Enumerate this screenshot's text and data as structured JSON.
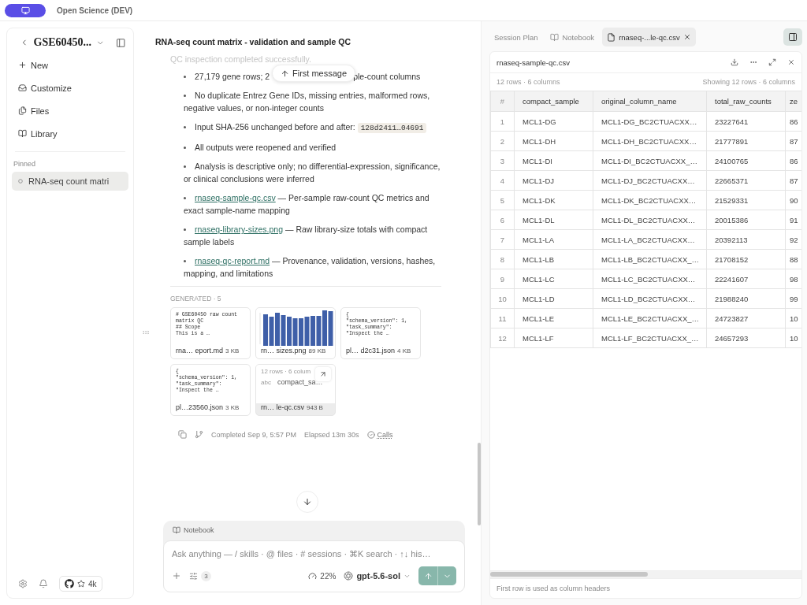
{
  "app": {
    "title": "Open Science (DEV)"
  },
  "sidebar": {
    "project": "GSE60450...",
    "nav": [
      {
        "label": "New"
      },
      {
        "label": "Customize"
      },
      {
        "label": "Files"
      },
      {
        "label": "Library"
      }
    ],
    "pinned_label": "Pinned",
    "pinned": [
      {
        "label": "RNA-seq count matri",
        "selected": true
      }
    ],
    "github_stars": "4k"
  },
  "chat": {
    "title": "RNA-seq count matrix - validation and sample QC",
    "faded_line": "QC inspection completed successfully.",
    "jump_button": "First message",
    "bullets": [
      {
        "kind": "split",
        "before": "27,179 gene rows; 2",
        "after": "ple-count columns"
      },
      {
        "kind": "text",
        "text": "No duplicate Entrez Gene IDs, missing entries, malformed rows, negative values, or non-integer counts"
      },
      {
        "kind": "code",
        "text": "Input SHA-256 unchanged before and after:",
        "code": "128d2411…04691"
      },
      {
        "kind": "text",
        "text": "All outputs were reopened and verified"
      },
      {
        "kind": "text",
        "text": "Analysis is descriptive only; no differential-expression, significance, or clinical conclusions were inferred"
      },
      {
        "kind": "link",
        "link": "rnaseq-sample-qc.csv",
        "text": " — Per-sample raw-count QC metrics and exact sample-name mapping"
      },
      {
        "kind": "link",
        "link": "rnaseq-library-sizes.png",
        "text": " — Raw library-size totals with compact sample labels"
      },
      {
        "kind": "link",
        "link": "rnaseq-qc-report.md",
        "text": " — Provenance, validation, versions, hashes, mapping, and limitations"
      }
    ],
    "generated_label": "GENERATED · 5",
    "files": [
      {
        "kind": "text",
        "preview": "# GSE60450 raw count\nmatrix QC\n## Scope\nThis is a …",
        "name": "rna… eport.md",
        "size": "3 KB",
        "selected": false
      },
      {
        "name": "rn… sizes.png",
        "size": "89 KB",
        "selected": false
      },
      {
        "kind": "text",
        "preview": "{\n\"schema_version\": 1,\n\"task_summary\":\n\"Inspect the …",
        "name": "pl… d2c31.json",
        "size": "4 KB",
        "selected": false
      },
      {
        "kind": "text",
        "preview": "{\n\"schema_version\": 1,\n\"task_summary\":\n\"Inspect the …",
        "name": "pl…23560.json",
        "size": "3 KB",
        "selected": false
      },
      {
        "kind": "table",
        "meta": "12 rows · 6 colum",
        "col_type": "abc",
        "col_name": "compact_sa…",
        "name": "rn… le-qc.csv",
        "size": "943 B",
        "selected": true
      }
    ],
    "completed": "Completed Sep 9, 5:57 PM",
    "elapsed": "Elapsed 13m 30s",
    "calls": "Calls"
  },
  "composer": {
    "mode": "Notebook",
    "placeholder": "Ask anything — / skills · @ files · # sessions · ⌘K search · ↑↓ his…",
    "tools_count": "3",
    "context": "22%",
    "model": "gpt-5.6-sol"
  },
  "panel": {
    "tabs": [
      {
        "label": "Session Plan",
        "selected": false,
        "closable": false
      },
      {
        "label": "Notebook",
        "selected": false,
        "closable": false
      },
      {
        "label": "rnaseq-...le-qc.csv",
        "selected": true,
        "closable": true
      }
    ],
    "file_title": "rnaseq-sample-qc.csv",
    "summary": "12 rows · 6 columns",
    "showing": "Showing 12 rows · 6 columns",
    "columns": [
      "#",
      "compact_sample",
      "original_column_name",
      "total_raw_counts",
      "ze"
    ],
    "rows": [
      [
        "1",
        "MCL1-DG",
        "MCL1-DG_BC2CTUACXX…",
        "23227641",
        "86"
      ],
      [
        "2",
        "MCL1-DH",
        "MCL1-DH_BC2CTUACXX…",
        "21777891",
        "87"
      ],
      [
        "3",
        "MCL1-DI",
        "MCL1-DI_BC2CTUACXX_…",
        "24100765",
        "86"
      ],
      [
        "4",
        "MCL1-DJ",
        "MCL1-DJ_BC2CTUACXX…",
        "22665371",
        "87"
      ],
      [
        "5",
        "MCL1-DK",
        "MCL1-DK_BC2CTUACXX…",
        "21529331",
        "90"
      ],
      [
        "6",
        "MCL1-DL",
        "MCL1-DL_BC2CTUACXX…",
        "20015386",
        "91"
      ],
      [
        "7",
        "MCL1-LA",
        "MCL1-LA_BC2CTUACXX…",
        "20392113",
        "92"
      ],
      [
        "8",
        "MCL1-LB",
        "MCL1-LB_BC2CTUACXX_…",
        "21708152",
        "88"
      ],
      [
        "9",
        "MCL1-LC",
        "MCL1-LC_BC2CTUACXX…",
        "22241607",
        "98"
      ],
      [
        "10",
        "MCL1-LD",
        "MCL1-LD_BC2CTUACXX…",
        "21988240",
        "99"
      ],
      [
        "11",
        "MCL1-LE",
        "MCL1-LE_BC2CTUACXX_…",
        "24723827",
        "10"
      ],
      [
        "12",
        "MCL1-LF",
        "MCL1-LF_BC2CTUACXX_…",
        "24657293",
        "10"
      ]
    ],
    "footer": "First row is used as column headers"
  }
}
